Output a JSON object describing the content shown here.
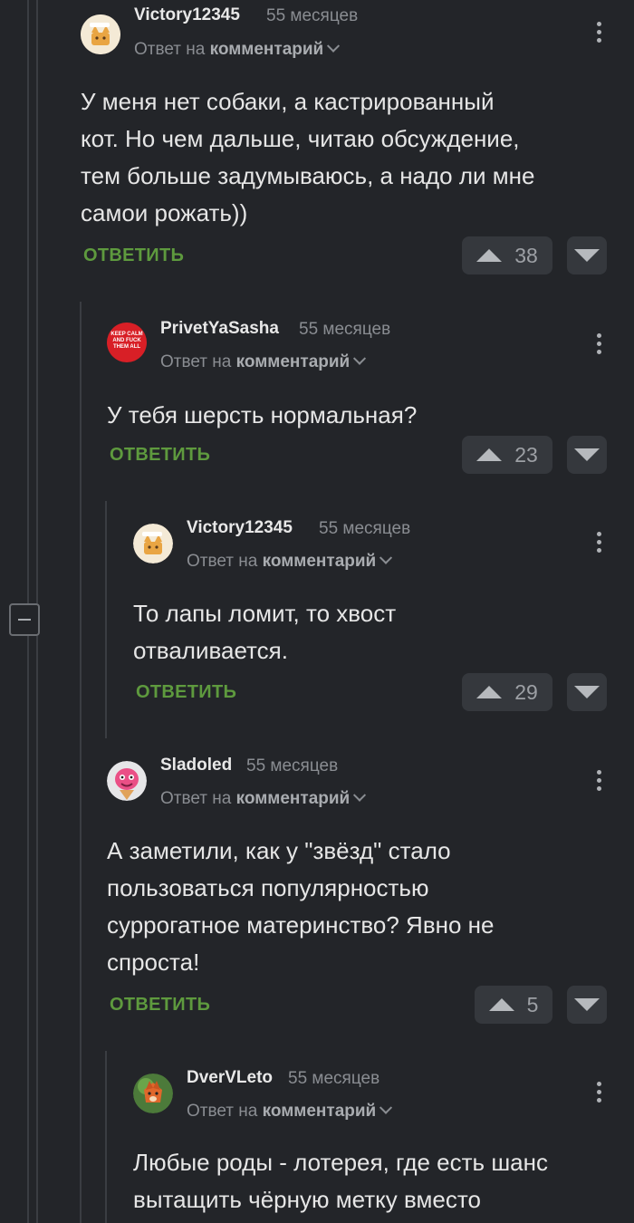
{
  "comments": [
    {
      "username": "Victory12345",
      "time": "55 месяцев",
      "reply_prefix": "Ответ на",
      "reply_target": "комментарий",
      "lines": [
        "У меня нет собаки, а кастрированный",
        "кот. Но чем дальше, читаю обсуждение,",
        "тем больше задумываюсь, а надо ли мне",
        "самои рожать))"
      ],
      "reply_label": "ОТВЕТИТЬ",
      "votes": "38",
      "avatar": "cat-avatar"
    },
    {
      "username": "PrivetYaSasha",
      "time": "55 месяцев",
      "reply_prefix": "Ответ на",
      "reply_target": "комментарий",
      "lines": [
        "У тебя шерсть нормальная?"
      ],
      "reply_label": "ОТВЕТИТЬ",
      "votes": "23",
      "avatar": "keep-calm-avatar",
      "avatar_text": "KEEP CALM AND FUCK THEM ALL"
    },
    {
      "username": "Victory12345",
      "time": "55 месяцев",
      "reply_prefix": "Ответ на",
      "reply_target": "комментарий",
      "lines": [
        "То лапы ломит, то хвост",
        "отваливается."
      ],
      "reply_label": "ОТВЕТИТЬ",
      "votes": "29",
      "avatar": "cat-avatar"
    },
    {
      "username": "Sladoled",
      "time": "55 месяцев",
      "reply_prefix": "Ответ на",
      "reply_target": "комментарий",
      "lines": [
        "А заметили, как у \"звёзд\" стало",
        "пользоваться популярностью",
        "суррогатное материнство? Явно не",
        "спроста!"
      ],
      "reply_label": "ОТВЕТИТЬ",
      "votes": "5",
      "avatar": "pink-monster-avatar"
    },
    {
      "username": "DverVLeto",
      "time": "55 месяцев",
      "reply_prefix": "Ответ на",
      "reply_target": "комментарий",
      "lines": [
        "Любые роды - лотерея, где есть шанс",
        "вытащить чёрную метку вместо"
      ],
      "avatar": "fox-avatar"
    }
  ],
  "colors": {
    "background": "#232529",
    "reply_green": "#5e9a3e",
    "vote_bg": "#35383d"
  }
}
